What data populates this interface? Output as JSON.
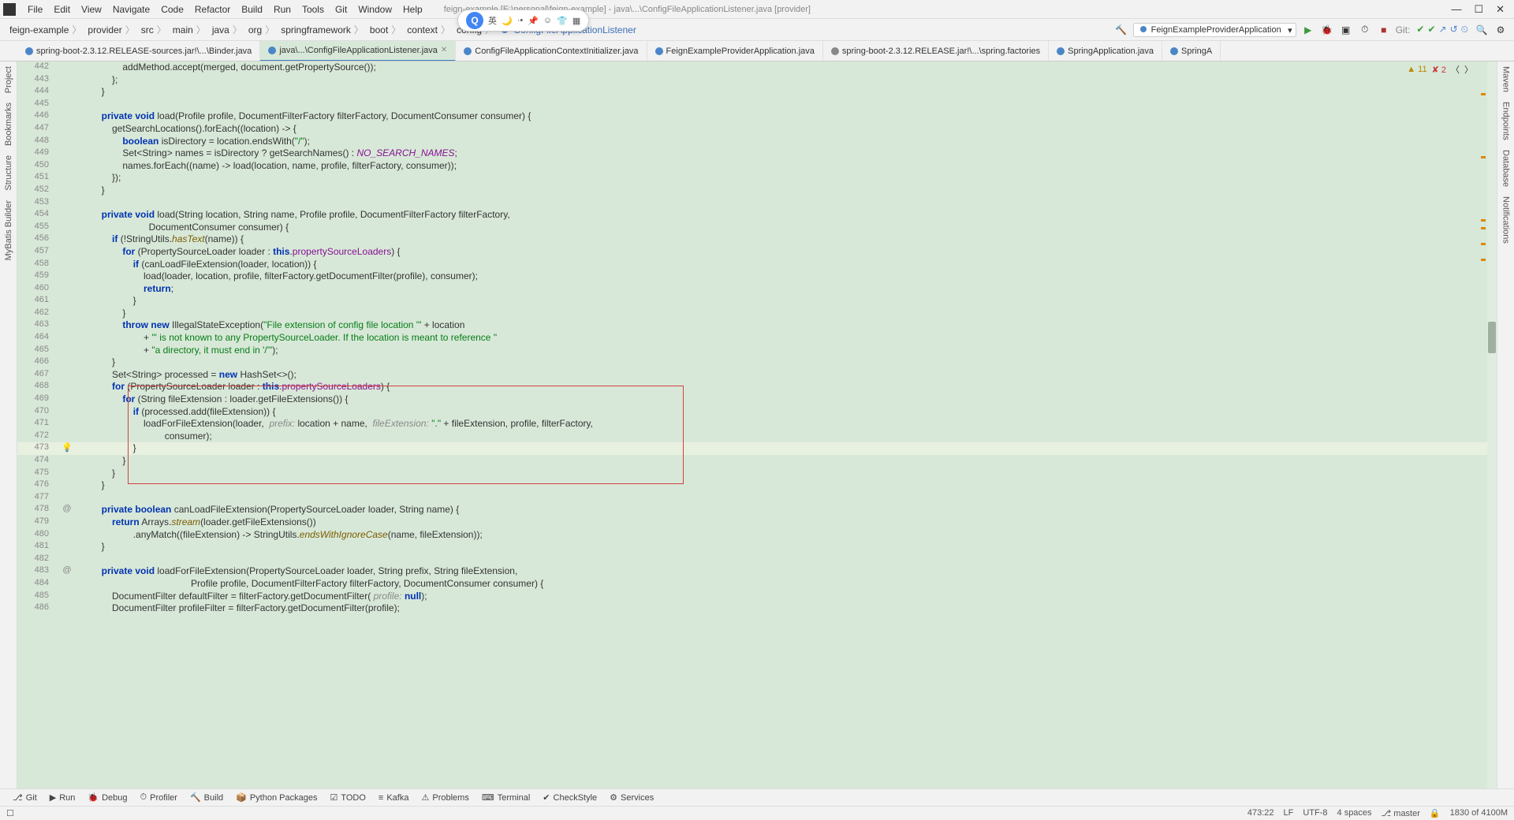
{
  "menu": [
    "File",
    "Edit",
    "View",
    "Navigate",
    "Code",
    "Refactor",
    "Build",
    "Run",
    "Tools",
    "Git",
    "Window",
    "Help"
  ],
  "window_title": "feign-example [E:\\personal\\feign-example] - java\\...\\ConfigFileApplicationListener.java [provider]",
  "breadcrumbs": [
    "feign-example",
    "provider",
    "src",
    "main",
    "java",
    "org",
    "springframework",
    "boot",
    "context",
    "config"
  ],
  "breadcrumb_active": "ConfigFileApplicationListener",
  "run_config": "FeignExampleProviderApplication",
  "git_label": "Git:",
  "tabs": [
    {
      "name": "spring-boot-2.3.12.RELEASE-sources.jar!\\...\\Binder.java",
      "icon": "b"
    },
    {
      "name": "java\\...\\ConfigFileApplicationListener.java",
      "icon": "b",
      "active": true
    },
    {
      "name": "ConfigFileApplicationContextInitializer.java",
      "icon": "b"
    },
    {
      "name": "FeignExampleProviderApplication.java",
      "icon": "b"
    },
    {
      "name": "spring-boot-2.3.12.RELEASE.jar!\\...\\spring.factories",
      "icon": "g"
    },
    {
      "name": "SpringApplication.java",
      "icon": "b"
    },
    {
      "name": "SpringA",
      "icon": "b"
    }
  ],
  "inspections": {
    "warn_count": "11",
    "err_count": "2"
  },
  "left_panels": [
    "Project",
    "Bookmarks",
    "Structure",
    "MyBatis Builder"
  ],
  "right_panels": [
    "Maven",
    "Endpoints",
    "Database",
    "Notifications"
  ],
  "code_lines": [
    {
      "ln": 442,
      "m": "",
      "t": "                addMethod.accept(merged, document.getPropertySource());"
    },
    {
      "ln": 443,
      "m": "",
      "t": "            };"
    },
    {
      "ln": 444,
      "m": "",
      "t": "        }"
    },
    {
      "ln": 445,
      "m": "",
      "t": ""
    },
    {
      "ln": 446,
      "m": "",
      "t": "        private void load(Profile profile, DocumentFilterFactory filterFactory, DocumentConsumer consumer) {",
      "kw": [
        "private",
        "void"
      ]
    },
    {
      "ln": 447,
      "m": "",
      "t": "            getSearchLocations().forEach((location) -> {"
    },
    {
      "ln": 448,
      "m": "",
      "t": "                boolean isDirectory = location.endsWith(\"/\");",
      "kw": [
        "boolean"
      ],
      "str": [
        "\"/\""
      ]
    },
    {
      "ln": 449,
      "m": "",
      "t": "                Set<String> names = isDirectory ? getSearchNames() : NO_SEARCH_NAMES;",
      "const": [
        "NO_SEARCH_NAMES"
      ]
    },
    {
      "ln": 450,
      "m": "",
      "t": "                names.forEach((name) -> load(location, name, profile, filterFactory, consumer));"
    },
    {
      "ln": 451,
      "m": "",
      "t": "            });"
    },
    {
      "ln": 452,
      "m": "",
      "t": "        }"
    },
    {
      "ln": 453,
      "m": "",
      "t": ""
    },
    {
      "ln": 454,
      "m": "",
      "t": "        private void load(String location, String name, Profile profile, DocumentFilterFactory filterFactory,",
      "kw": [
        "private",
        "void"
      ]
    },
    {
      "ln": 455,
      "m": "",
      "t": "                          DocumentConsumer consumer) {"
    },
    {
      "ln": 456,
      "m": "",
      "t": "            if (!StringUtils.hasText(name)) {",
      "kw": [
        "if"
      ],
      "mth": [
        "hasText"
      ]
    },
    {
      "ln": 457,
      "m": "",
      "t": "                for (PropertySourceLoader loader : this.propertySourceLoaders) {",
      "kw": [
        "for",
        "this"
      ],
      "fld": [
        "propertySourceLoaders"
      ]
    },
    {
      "ln": 458,
      "m": "",
      "t": "                    if (canLoadFileExtension(loader, location)) {",
      "kw": [
        "if"
      ]
    },
    {
      "ln": 459,
      "m": "",
      "t": "                        load(loader, location, profile, filterFactory.getDocumentFilter(profile), consumer);"
    },
    {
      "ln": 460,
      "m": "",
      "t": "                        return;",
      "kw": [
        "return"
      ]
    },
    {
      "ln": 461,
      "m": "",
      "t": "                    }"
    },
    {
      "ln": 462,
      "m": "",
      "t": "                }"
    },
    {
      "ln": 463,
      "m": "",
      "t": "                throw new IllegalStateException(\"File extension of config file location '\" + location",
      "kw": [
        "throw",
        "new"
      ],
      "str": [
        "\"File extension of config file location '\""
      ]
    },
    {
      "ln": 464,
      "m": "",
      "t": "                        + \"' is not known to any PropertySourceLoader. If the location is meant to reference \"",
      "str": [
        "\"' is not known to any PropertySourceLoader. If the location is meant to reference \""
      ]
    },
    {
      "ln": 465,
      "m": "",
      "t": "                        + \"a directory, it must end in '/'\");",
      "str": [
        "\"a directory, it must end in '/'\""
      ]
    },
    {
      "ln": 466,
      "m": "",
      "t": "            }"
    },
    {
      "ln": 467,
      "m": "",
      "t": "            Set<String> processed = new HashSet<>();",
      "kw": [
        "new"
      ]
    },
    {
      "ln": 468,
      "m": "",
      "t": "            for (PropertySourceLoader loader : this.propertySourceLoaders) {",
      "kw": [
        "for",
        "this"
      ],
      "fld": [
        "propertySourceLoaders"
      ]
    },
    {
      "ln": 469,
      "m": "",
      "t": "                for (String fileExtension : loader.getFileExtensions()) {",
      "kw": [
        "for"
      ]
    },
    {
      "ln": 470,
      "m": "",
      "t": "                    if (processed.add(fileExtension)) {",
      "kw": [
        "if"
      ]
    },
    {
      "ln": 471,
      "m": "",
      "t": "                        loadForFileExtension(loader,  prefix: location + name,  fileExtension: \".\" + fileExtension, profile, filterFactory,",
      "ann": [
        "prefix:",
        "fileExtension:"
      ],
      "str": [
        "\".\""
      ]
    },
    {
      "ln": 472,
      "m": "",
      "t": "                                consumer);"
    },
    {
      "ln": 473,
      "m": "💡",
      "t": "                    }",
      "current": true
    },
    {
      "ln": 474,
      "m": "",
      "t": "                }"
    },
    {
      "ln": 475,
      "m": "",
      "t": "            }"
    },
    {
      "ln": 476,
      "m": "",
      "t": "        }"
    },
    {
      "ln": 477,
      "m": "",
      "t": ""
    },
    {
      "ln": 478,
      "m": "@",
      "t": "        private boolean canLoadFileExtension(PropertySourceLoader loader, String name) {",
      "kw": [
        "private",
        "boolean"
      ]
    },
    {
      "ln": 479,
      "m": "",
      "t": "            return Arrays.stream(loader.getFileExtensions())",
      "kw": [
        "return"
      ],
      "mth": [
        "stream"
      ]
    },
    {
      "ln": 480,
      "m": "",
      "t": "                    .anyMatch((fileExtension) -> StringUtils.endsWithIgnoreCase(name, fileExtension));",
      "mth": [
        "endsWithIgnoreCase"
      ]
    },
    {
      "ln": 481,
      "m": "",
      "t": "        }"
    },
    {
      "ln": 482,
      "m": "",
      "t": ""
    },
    {
      "ln": 483,
      "m": "@",
      "t": "        private void loadForFileExtension(PropertySourceLoader loader, String prefix, String fileExtension,",
      "kw": [
        "private",
        "void"
      ]
    },
    {
      "ln": 484,
      "m": "",
      "t": "                                          Profile profile, DocumentFilterFactory filterFactory, DocumentConsumer consumer) {"
    },
    {
      "ln": 485,
      "m": "",
      "t": "            DocumentFilter defaultFilter = filterFactory.getDocumentFilter( profile: null);",
      "ann": [
        "profile:"
      ],
      "kw": [
        "null"
      ]
    },
    {
      "ln": 486,
      "m": "",
      "t": "            DocumentFilter profileFilter = filterFactory.getDocumentFilter(profile);"
    }
  ],
  "bottom_tools": [
    "Git",
    "Run",
    "Debug",
    "Profiler",
    "Build",
    "Python Packages",
    "TODO",
    "Kafka",
    "Problems",
    "Terminal",
    "CheckStyle",
    "Services"
  ],
  "status": {
    "pos": "473:22",
    "sep": "LF",
    "enc": "UTF-8",
    "indent": "4 spaces",
    "branch": "master",
    "mem": "1830 of 4100M"
  },
  "floating": {
    "q": "Q",
    "lang": "英"
  }
}
